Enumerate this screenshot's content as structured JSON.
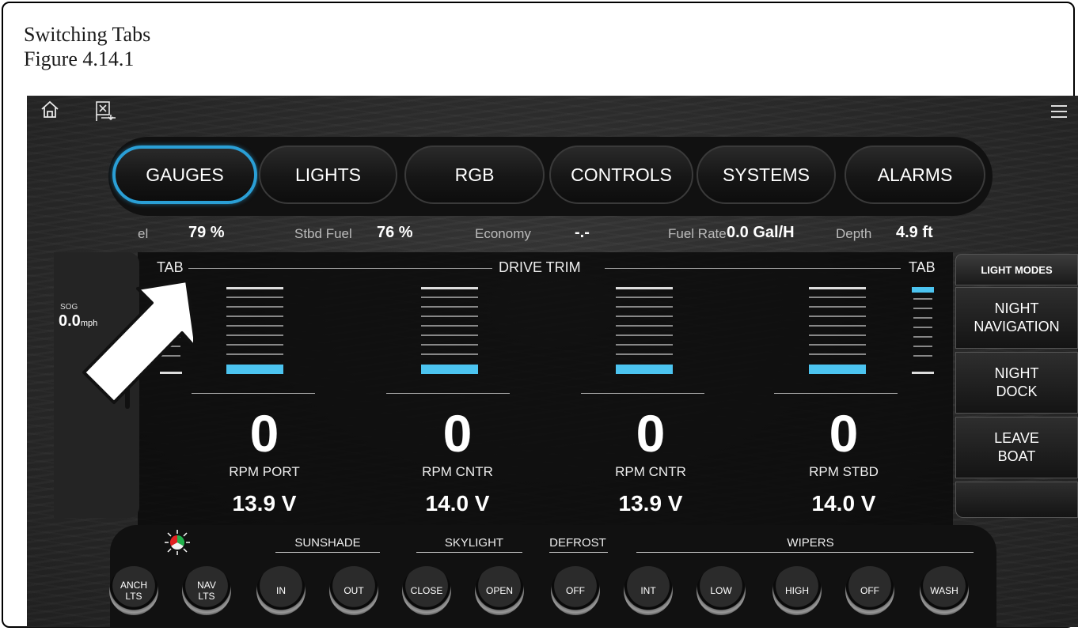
{
  "caption": {
    "line1": "Switching Tabs",
    "line2": "Figure 4.14.1"
  },
  "tabs": [
    "GAUGES",
    "LIGHTS",
    "RGB",
    "CONTROLS",
    "SYSTEMS",
    "ALARMS"
  ],
  "active_tab": "GAUGES",
  "info": {
    "port_fuel_label": "el",
    "port_fuel": "79 %",
    "stbd_fuel_label": "Stbd Fuel",
    "stbd_fuel": "76 %",
    "economy_label": "Economy",
    "economy": "-.-",
    "fuel_rate_label": "Fuel Rate",
    "fuel_rate": "0.0 Gal/H",
    "depth_label": "Depth",
    "depth": "4.9 ft"
  },
  "sog": {
    "label": "SOG",
    "value": "0.0",
    "unit": "mph"
  },
  "trim": {
    "left_tab": "TAB",
    "title": "DRIVE TRIM",
    "right_tab": "TAB"
  },
  "engines": [
    {
      "rpm": "0",
      "label": "RPM PORT",
      "volts": "13.9 V"
    },
    {
      "rpm": "0",
      "label": "RPM CNTR",
      "volts": "14.0 V"
    },
    {
      "rpm": "0",
      "label": "RPM CNTR",
      "volts": "13.9 V"
    },
    {
      "rpm": "0",
      "label": "RPM STBD",
      "volts": "14.0 V"
    }
  ],
  "light_modes": {
    "header": "LIGHT MODES",
    "buttons": [
      "NIGHT\nNAVIGATION",
      "NIGHT\nDOCK",
      "LEAVE\nBOAT",
      ""
    ]
  },
  "controls": {
    "groups": {
      "sunshade": "SUNSHADE",
      "skylight": "SKYLIGHT",
      "defrost": "DEFROST",
      "wipers": "WIPERS"
    },
    "buttons": [
      "ANCH\nLTS",
      "NAV\nLTS",
      "IN",
      "OUT",
      "CLOSE",
      "OPEN",
      "OFF",
      "INT",
      "LOW",
      "HIGH",
      "OFF",
      "WASH"
    ]
  },
  "colors": {
    "accent_blue": "#2a9fd6",
    "indicator_blue": "#4cc4f0"
  }
}
